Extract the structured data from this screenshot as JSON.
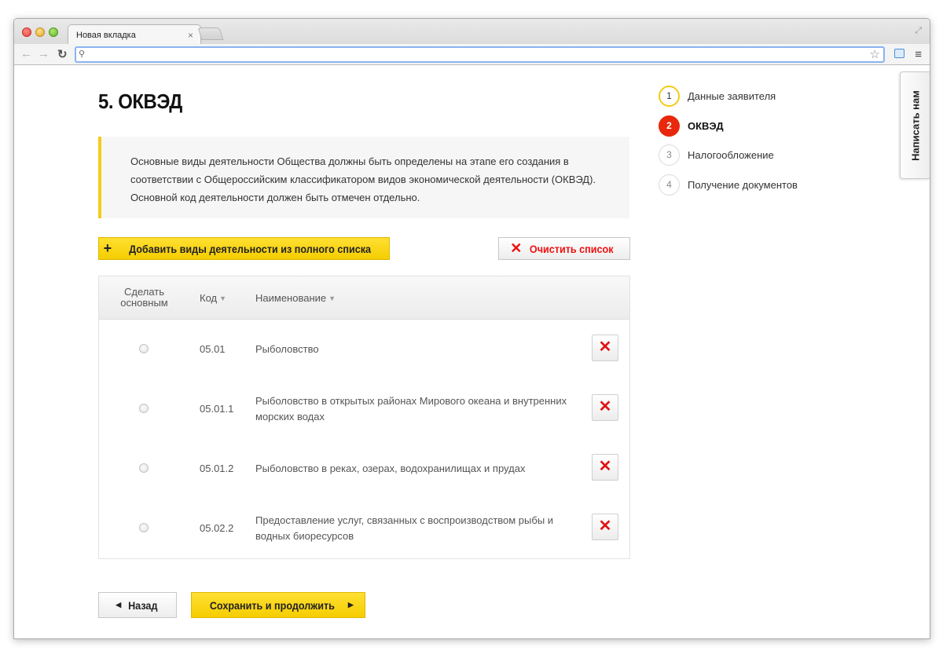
{
  "browser": {
    "tab_title": "Новая вкладка",
    "tab_close": "×",
    "address_value": "",
    "icons": [
      "back-arrow-icon",
      "forward-arrow-icon",
      "reload-icon",
      "search-icon",
      "star-icon",
      "extension-icon",
      "menu-icon",
      "fullscreen-icon"
    ]
  },
  "page": {
    "title": "5. ОКВЭД",
    "info_text": "Основные виды деятельности Общества должны быть определены на этапе его создания в соответствии с Общероссийским классификатором видов экономической деятельности (ОКВЭД). Основной код деятельности должен быть отмечен отдельно.",
    "add_button": "Добавить виды деятельности из полного списка",
    "clear_button": "Очистить список",
    "table": {
      "headers": {
        "main": "Сделать основным",
        "code": "Код",
        "name": "Наименование"
      },
      "rows": [
        {
          "code": "05.01",
          "name": "Рыболовство"
        },
        {
          "code": "05.01.1",
          "name": "Рыболовство в открытых районах Мирового океана и внутренних морских водах"
        },
        {
          "code": "05.01.2",
          "name": "Рыболовство в реках, озерах, водохранилищах и прудах"
        },
        {
          "code": "05.02.2",
          "name": "Предоставление услуг, связанных с воспроизводством рыбы и водных биоресурсов"
        }
      ]
    },
    "back_button": "Назад",
    "save_button": "Сохранить и продолжить"
  },
  "steps": [
    {
      "num": "1",
      "label": "Данные заявителя",
      "state": "done"
    },
    {
      "num": "2",
      "label": "ОКВЭД",
      "state": "active"
    },
    {
      "num": "3",
      "label": "Налогообложение",
      "state": "pending"
    },
    {
      "num": "4",
      "label": "Получение документов",
      "state": "pending"
    }
  ],
  "feedback_tab": "Написать нам",
  "colors": {
    "accent_yellow": "#f5cd00",
    "active_step_red": "#e8280c",
    "delete_red": "#e01414"
  }
}
